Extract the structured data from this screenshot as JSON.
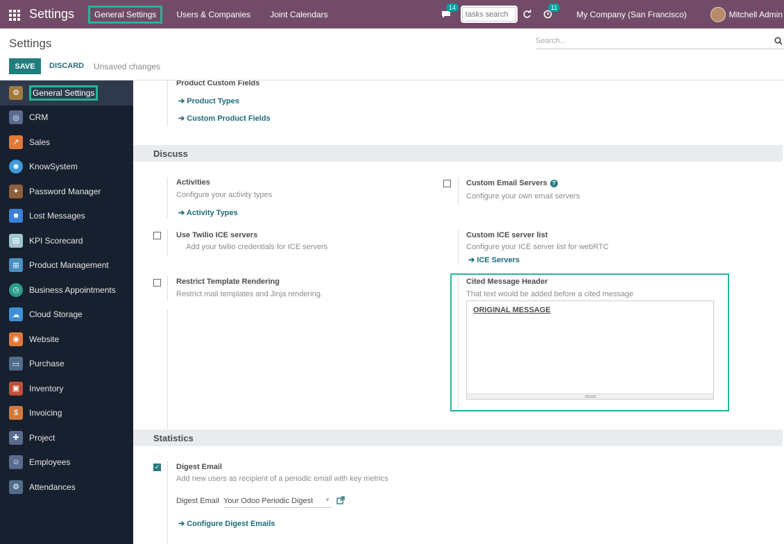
{
  "navbar": {
    "app_title": "Settings",
    "menu": [
      "General Settings",
      "Users & Companies",
      "Joint Calendars"
    ],
    "messages_badge": "14",
    "tasks_search_placeholder": "tasks search",
    "activities_badge": "11",
    "company": "My Company (San Francisco)",
    "user": "Mitchell Admin"
  },
  "control_panel": {
    "title": "Settings",
    "search_placeholder": "Search...",
    "save_label": "SAVE",
    "discard_label": "DISCARD",
    "status": "Unsaved changes"
  },
  "sidebar": {
    "items": [
      {
        "label": "General Settings",
        "icon": "gear-icon",
        "color": "#a07b3e"
      },
      {
        "label": "CRM",
        "icon": "crm-icon",
        "color": "#5b6b8f"
      },
      {
        "label": "Sales",
        "icon": "sales-chart-icon",
        "color": "#e07a3b"
      },
      {
        "label": "KnowSystem",
        "icon": "brain-icon",
        "color": "#3d9ad8"
      },
      {
        "label": "Password Manager",
        "icon": "puzzle-icon",
        "color": "#8c5f3f"
      },
      {
        "label": "Lost Messages",
        "icon": "user-icon",
        "color": "#3c7fd6"
      },
      {
        "label": "KPI Scorecard",
        "icon": "scorecard-icon",
        "color": "#9ec6cf"
      },
      {
        "label": "Product Management",
        "icon": "sitemap-icon",
        "color": "#4a90c2"
      },
      {
        "label": "Business Appointments",
        "icon": "clock-icon",
        "color": "#2a9d8f"
      },
      {
        "label": "Cloud Storage",
        "icon": "cloud-icon",
        "color": "#3d8fd8"
      },
      {
        "label": "Website",
        "icon": "website-icon",
        "color": "#e07a3b"
      },
      {
        "label": "Purchase",
        "icon": "purchase-icon",
        "color": "#4f6d8a"
      },
      {
        "label": "Inventory",
        "icon": "inventory-icon",
        "color": "#c0503a"
      },
      {
        "label": "Invoicing",
        "icon": "invoice-icon",
        "color": "#d07a3b"
      },
      {
        "label": "Project",
        "icon": "project-icon",
        "color": "#5b6b8f"
      },
      {
        "label": "Employees",
        "icon": "employees-icon",
        "color": "#5b6b8f"
      },
      {
        "label": "Attendances",
        "icon": "attendance-icon",
        "color": "#4f6d8a"
      }
    ]
  },
  "product_fields": {
    "title": "Product Custom Fields",
    "link1": "Product Types",
    "link2": "Custom Product Fields"
  },
  "discuss": {
    "section": "Discuss",
    "activities_title": "Activities",
    "activities_desc": "Configure your activity types",
    "activities_link": "Activity Types",
    "email_servers_title": "Custom Email Servers",
    "email_servers_desc": "Configure your own email servers",
    "twilio_title": "Use Twilio ICE servers",
    "twilio_desc": "Add your twilio credentials for ICE servers",
    "ice_title": "Custom ICE server list",
    "ice_desc": "Configure your ICE server list for webRTC",
    "ice_link": "ICE Servers",
    "restrict_title": "Restrict Template Rendering",
    "restrict_desc": "Restrict mail templates and Jinja rendering.",
    "cited_title": "Cited Message Header",
    "cited_desc": "That text would be added before a cited message",
    "cited_value": "ORIGINAL MESSAGE"
  },
  "statistics": {
    "section": "Statistics",
    "digest_title": "Digest Email",
    "digest_desc": "Add new users as recipient of a periodic email with key metrics",
    "digest_label": "Digest Email",
    "digest_value": "Your Odoo Periodic Digest",
    "configure_link": "Configure Digest Emails"
  },
  "colors": {
    "navbar": "#714b67",
    "accent": "#21b799",
    "primary": "#217c7e",
    "sidebar": "#17202e"
  }
}
